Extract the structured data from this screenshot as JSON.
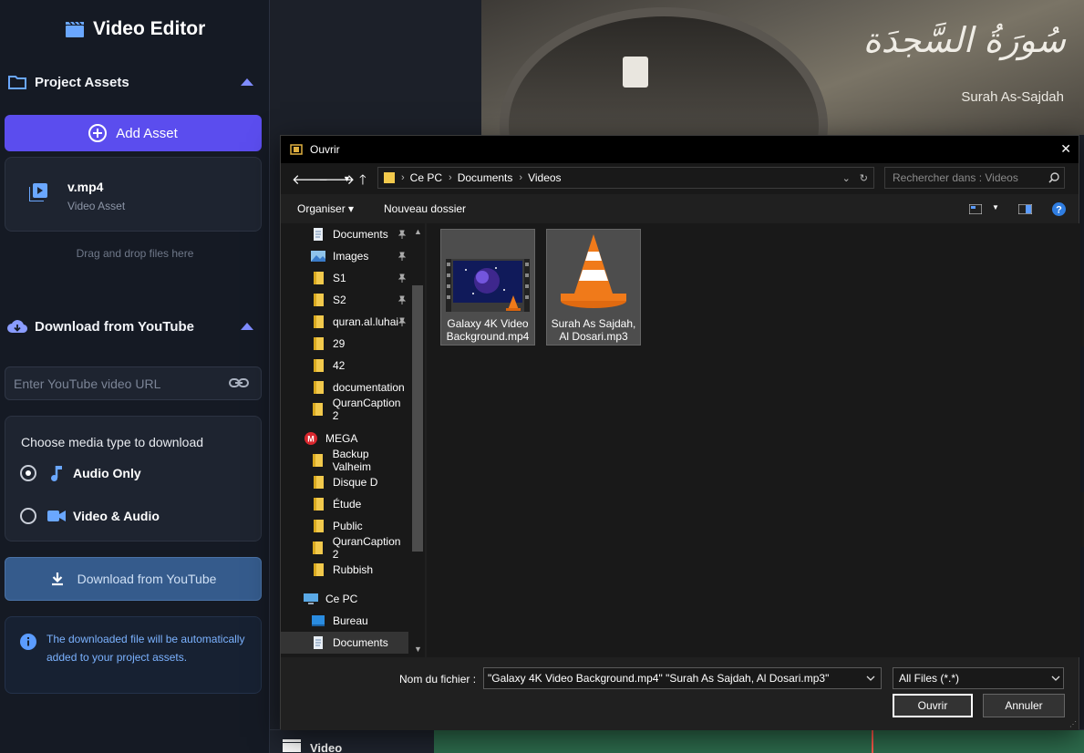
{
  "app": {
    "title": "Video Editor"
  },
  "assets": {
    "heading": "Project Assets",
    "add_label": "Add Asset",
    "items": [
      {
        "name": "v.mp4",
        "type": "Video Asset"
      }
    ],
    "drop_hint": "Drag and drop files here"
  },
  "youtube": {
    "heading": "Download from YouTube",
    "url_placeholder": "Enter YouTube video URL",
    "media_title": "Choose media type to download",
    "options": [
      {
        "label": "Audio Only",
        "selected": true
      },
      {
        "label": "Video & Audio",
        "selected": false
      }
    ],
    "download_label": "Download from YouTube",
    "info": "The downloaded file will be automatically added to your project assets."
  },
  "preview": {
    "calligraphy": "سُورَةُ السَّجدَة",
    "surah_name": "Surah As-Sajdah",
    "timeline_label": "Video"
  },
  "dialog": {
    "title": "Ouvrir",
    "close": "✕",
    "path": [
      "Ce PC",
      "Documents",
      "Videos"
    ],
    "search_placeholder": "Rechercher dans : Videos",
    "toolbar": {
      "organize": "Organiser ▾",
      "new_folder": "Nouveau dossier"
    },
    "tree": [
      {
        "label": "Documents",
        "icon": "document-icon",
        "pinned": true,
        "indent": 1
      },
      {
        "label": "Images",
        "icon": "image-icon",
        "pinned": true,
        "indent": 1
      },
      {
        "label": "S1",
        "icon": "folder-icon",
        "pinned": true,
        "indent": 1
      },
      {
        "label": "S2",
        "icon": "folder-icon",
        "pinned": true,
        "indent": 1
      },
      {
        "label": "quran.al.luhai",
        "icon": "folder-icon",
        "pinned": true,
        "indent": 1
      },
      {
        "label": "29",
        "icon": "folder-icon",
        "pinned": false,
        "indent": 1
      },
      {
        "label": "42",
        "icon": "folder-icon",
        "pinned": false,
        "indent": 1
      },
      {
        "label": "documentation",
        "icon": "folder-icon",
        "pinned": false,
        "indent": 1
      },
      {
        "label": "QuranCaption 2",
        "icon": "folder-icon",
        "pinned": false,
        "indent": 1
      },
      {
        "label": "MEGA",
        "icon": "mega-icon",
        "pinned": false,
        "indent": 0
      },
      {
        "label": "Backup Valheim",
        "icon": "folder-icon",
        "pinned": false,
        "indent": 1
      },
      {
        "label": "Disque D",
        "icon": "folder-icon",
        "pinned": false,
        "indent": 1
      },
      {
        "label": "Étude",
        "icon": "folder-icon",
        "pinned": false,
        "indent": 1
      },
      {
        "label": "Public",
        "icon": "folder-icon",
        "pinned": false,
        "indent": 1
      },
      {
        "label": "QuranCaption 2",
        "icon": "folder-icon",
        "pinned": false,
        "indent": 1
      },
      {
        "label": "Rubbish",
        "icon": "folder-icon",
        "pinned": false,
        "indent": 1
      },
      {
        "label": "Ce PC",
        "icon": "computer-icon",
        "pinned": false,
        "indent": 0
      },
      {
        "label": "Bureau",
        "icon": "desktop-icon",
        "pinned": false,
        "indent": 1
      },
      {
        "label": "Documents",
        "icon": "document-icon",
        "pinned": false,
        "indent": 1,
        "selected": true
      }
    ],
    "files": [
      {
        "name": "Galaxy 4K Video Background.mp4",
        "kind": "video"
      },
      {
        "name": "Surah As Sajdah, Al Dosari.mp3",
        "kind": "audio"
      }
    ],
    "filename_label": "Nom du fichier :",
    "filename_value": "\"Galaxy 4K Video Background.mp4\" \"Surah As Sajdah, Al Dosari.mp3\"",
    "filter": "All Files (*.*)",
    "open_label": "Ouvrir",
    "cancel_label": "Annuler"
  },
  "colors": {
    "accent": "#5b4dee",
    "sidebar_bg": "#151a24",
    "youtube_button": "#355b8c",
    "info_text": "#7bb2ff"
  }
}
